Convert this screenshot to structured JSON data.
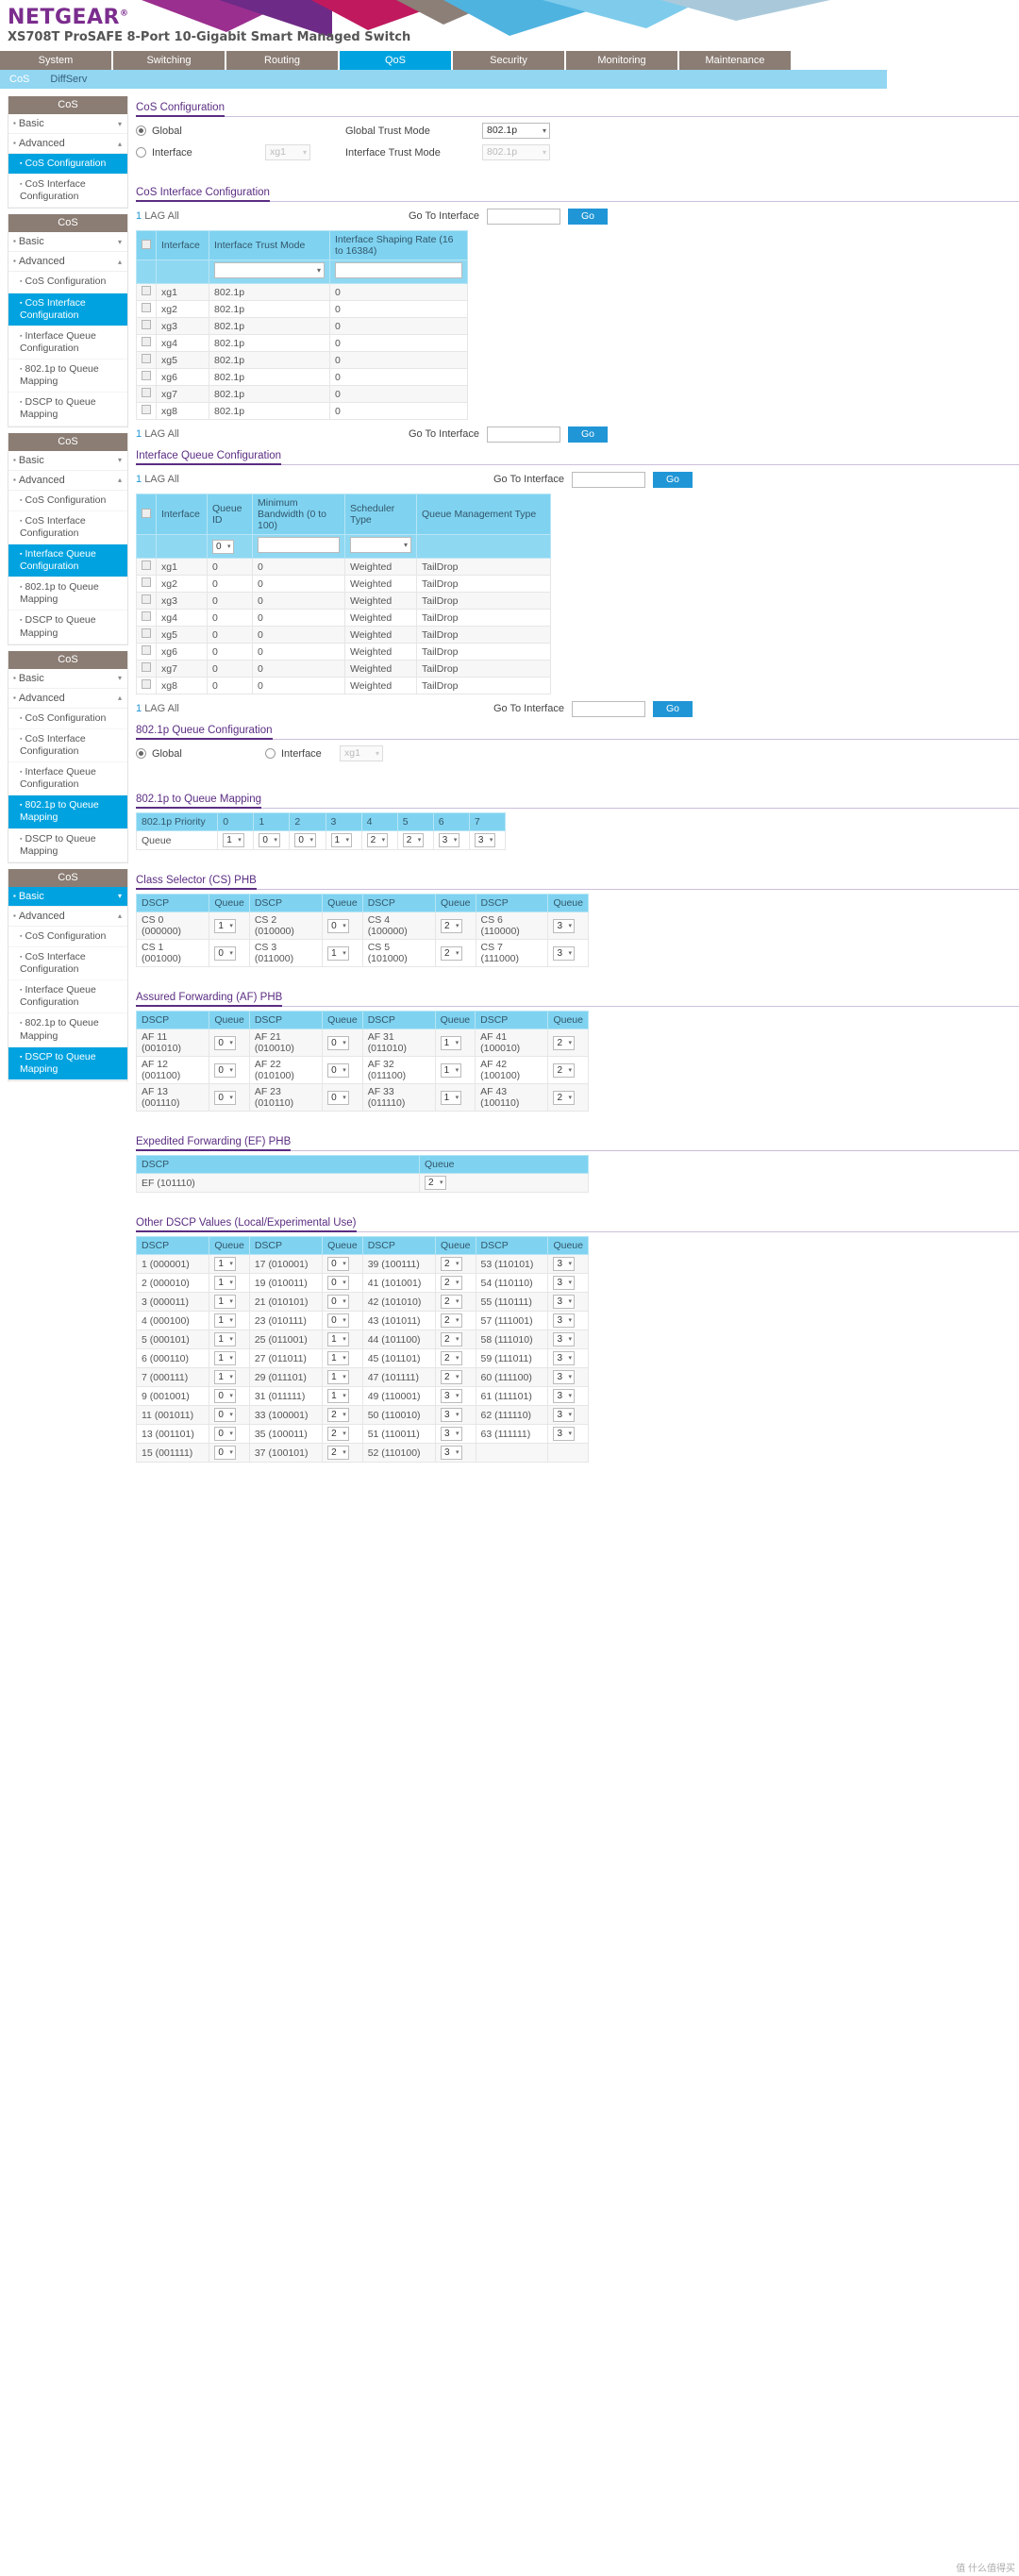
{
  "header": {
    "brand": "NETGEAR",
    "model": "XS708T ProSAFE 8-Port 10-Gigabit Smart Managed Switch"
  },
  "tabs": [
    {
      "label": "System",
      "active": false
    },
    {
      "label": "Switching",
      "active": false
    },
    {
      "label": "Routing",
      "active": false
    },
    {
      "label": "QoS",
      "active": true
    },
    {
      "label": "Security",
      "active": false
    },
    {
      "label": "Monitoring",
      "active": false
    },
    {
      "label": "Maintenance",
      "active": false
    }
  ],
  "subnav": [
    {
      "label": "CoS",
      "active": true
    },
    {
      "label": "DiffServ",
      "active": false
    }
  ],
  "sidebar": {
    "title": "CoS",
    "blocks": [
      {
        "basic": "Basic",
        "advanced": "Advanced",
        "items": [
          {
            "label": "CoS Configuration",
            "selected": true
          },
          {
            "label": "CoS Interface Configuration",
            "selected": false
          }
        ]
      },
      {
        "basic": "Basic",
        "advanced": "Advanced",
        "items": [
          {
            "label": "CoS Configuration",
            "selected": false
          },
          {
            "label": "CoS Interface Configuration",
            "selected": true
          },
          {
            "label": "Interface Queue Configuration",
            "selected": false
          },
          {
            "label": "802.1p to Queue Mapping",
            "selected": false
          },
          {
            "label": "DSCP to Queue Mapping",
            "selected": false
          }
        ]
      },
      {
        "basic": "Basic",
        "advanced": "Advanced",
        "items": [
          {
            "label": "CoS Configuration",
            "selected": false
          },
          {
            "label": "CoS Interface Configuration",
            "selected": false
          },
          {
            "label": "Interface Queue Configuration",
            "selected": true
          },
          {
            "label": "802.1p to Queue Mapping",
            "selected": false
          },
          {
            "label": "DSCP to Queue Mapping",
            "selected": false
          }
        ]
      },
      {
        "basic": "Basic",
        "advanced": "Advanced",
        "items": [
          {
            "label": "CoS Configuration",
            "selected": false
          },
          {
            "label": "CoS Interface Configuration",
            "selected": false
          },
          {
            "label": "Interface Queue Configuration",
            "selected": false
          },
          {
            "label": "802.1p to Queue Mapping",
            "selected": true
          },
          {
            "label": "DSCP to Queue Mapping",
            "selected": false
          }
        ]
      },
      {
        "basic": "Basic",
        "advanced": "Advanced",
        "basic_selected": true,
        "items": [
          {
            "label": "CoS Configuration",
            "selected": false
          },
          {
            "label": "CoS Interface Configuration",
            "selected": false
          },
          {
            "label": "Interface Queue Configuration",
            "selected": false
          },
          {
            "label": "802.1p to Queue Mapping",
            "selected": false
          },
          {
            "label": "DSCP to Queue Mapping",
            "selected": true
          }
        ]
      }
    ]
  },
  "cos_configuration": {
    "heading": "CoS Configuration",
    "global_label": "Global",
    "interface_label": "Interface",
    "global_trust_label": "Global Trust Mode",
    "interface_trust_label": "Interface Trust Mode",
    "global_trust_value": "802.1p",
    "interface_trust_value": "802.1p",
    "interface_select_value": "xg1",
    "global_selected": true
  },
  "cos_interface_configuration": {
    "heading": "CoS Interface Configuration",
    "lag_all": {
      "num": "1",
      "text": "LAG All"
    },
    "goto_label": "Go To Interface",
    "goto_value": "",
    "go_button": "Go",
    "columns": [
      "Interface",
      "Interface Trust Mode",
      "Interface Shaping Rate (16 to 16384)"
    ],
    "filter": {
      "trust_mode": "",
      "shaping_rate": ""
    },
    "rows": [
      {
        "interface": "xg1",
        "trust_mode": "802.1p",
        "shaping_rate": "0"
      },
      {
        "interface": "xg2",
        "trust_mode": "802.1p",
        "shaping_rate": "0"
      },
      {
        "interface": "xg3",
        "trust_mode": "802.1p",
        "shaping_rate": "0"
      },
      {
        "interface": "xg4",
        "trust_mode": "802.1p",
        "shaping_rate": "0"
      },
      {
        "interface": "xg5",
        "trust_mode": "802.1p",
        "shaping_rate": "0"
      },
      {
        "interface": "xg6",
        "trust_mode": "802.1p",
        "shaping_rate": "0"
      },
      {
        "interface": "xg7",
        "trust_mode": "802.1p",
        "shaping_rate": "0"
      },
      {
        "interface": "xg8",
        "trust_mode": "802.1p",
        "shaping_rate": "0"
      }
    ]
  },
  "interface_queue_configuration": {
    "heading": "Interface Queue Configuration",
    "lag_all": {
      "num": "1",
      "text": "LAG All"
    },
    "goto_label": "Go To Interface",
    "goto_value": "",
    "go_button": "Go",
    "columns": [
      "Interface",
      "Queue ID",
      "Minimum Bandwidth (0 to 100)",
      "Scheduler Type",
      "Queue Management Type"
    ],
    "filter": {
      "queue_id": "0",
      "min_bandwidth": "",
      "scheduler_type": ""
    },
    "rows": [
      {
        "interface": "xg1",
        "queue_id": "0",
        "min_bw": "0",
        "scheduler": "Weighted",
        "qmt": "TailDrop"
      },
      {
        "interface": "xg2",
        "queue_id": "0",
        "min_bw": "0",
        "scheduler": "Weighted",
        "qmt": "TailDrop"
      },
      {
        "interface": "xg3",
        "queue_id": "0",
        "min_bw": "0",
        "scheduler": "Weighted",
        "qmt": "TailDrop"
      },
      {
        "interface": "xg4",
        "queue_id": "0",
        "min_bw": "0",
        "scheduler": "Weighted",
        "qmt": "TailDrop"
      },
      {
        "interface": "xg5",
        "queue_id": "0",
        "min_bw": "0",
        "scheduler": "Weighted",
        "qmt": "TailDrop"
      },
      {
        "interface": "xg6",
        "queue_id": "0",
        "min_bw": "0",
        "scheduler": "Weighted",
        "qmt": "TailDrop"
      },
      {
        "interface": "xg7",
        "queue_id": "0",
        "min_bw": "0",
        "scheduler": "Weighted",
        "qmt": "TailDrop"
      },
      {
        "interface": "xg8",
        "queue_id": "0",
        "min_bw": "0",
        "scheduler": "Weighted",
        "qmt": "TailDrop"
      }
    ]
  },
  "dot1p_queue_configuration": {
    "heading": "802.1p Queue Configuration",
    "global_label": "Global",
    "interface_label": "Interface",
    "interface_value": "xg1",
    "global_selected": true
  },
  "dot1p_to_queue_mapping": {
    "heading": "802.1p to Queue Mapping",
    "priority_label": "802.1p Priority",
    "queue_label": "Queue",
    "priorities": [
      "0",
      "1",
      "2",
      "3",
      "4",
      "5",
      "6",
      "7"
    ],
    "queues": [
      "1",
      "0",
      "0",
      "1",
      "2",
      "2",
      "3",
      "3"
    ]
  },
  "cs_phb": {
    "heading": "Class Selector (CS) PHB",
    "columns": [
      "DSCP",
      "Queue",
      "DSCP",
      "Queue",
      "DSCP",
      "Queue",
      "DSCP",
      "Queue"
    ],
    "rows": [
      [
        {
          "dscp": "CS 0 (000000)",
          "q": "1"
        },
        {
          "dscp": "CS 2 (010000)",
          "q": "0"
        },
        {
          "dscp": "CS 4 (100000)",
          "q": "2"
        },
        {
          "dscp": "CS 6 (110000)",
          "q": "3"
        }
      ],
      [
        {
          "dscp": "CS 1 (001000)",
          "q": "0"
        },
        {
          "dscp": "CS 3 (011000)",
          "q": "1"
        },
        {
          "dscp": "CS 5 (101000)",
          "q": "2"
        },
        {
          "dscp": "CS 7 (111000)",
          "q": "3"
        }
      ]
    ]
  },
  "af_phb": {
    "heading": "Assured Forwarding (AF) PHB",
    "columns": [
      "DSCP",
      "Queue",
      "DSCP",
      "Queue",
      "DSCP",
      "Queue",
      "DSCP",
      "Queue"
    ],
    "rows": [
      [
        {
          "dscp": "AF 11 (001010)",
          "q": "0"
        },
        {
          "dscp": "AF 21 (010010)",
          "q": "0"
        },
        {
          "dscp": "AF 31 (011010)",
          "q": "1"
        },
        {
          "dscp": "AF 41 (100010)",
          "q": "2"
        }
      ],
      [
        {
          "dscp": "AF 12 (001100)",
          "q": "0"
        },
        {
          "dscp": "AF 22 (010100)",
          "q": "0"
        },
        {
          "dscp": "AF 32 (011100)",
          "q": "1"
        },
        {
          "dscp": "AF 42 (100100)",
          "q": "2"
        }
      ],
      [
        {
          "dscp": "AF 13 (001110)",
          "q": "0"
        },
        {
          "dscp": "AF 23 (010110)",
          "q": "0"
        },
        {
          "dscp": "AF 33 (011110)",
          "q": "1"
        },
        {
          "dscp": "AF 43 (100110)",
          "q": "2"
        }
      ]
    ]
  },
  "ef_phb": {
    "heading": "Expedited Forwarding (EF) PHB",
    "columns": [
      "DSCP",
      "Queue"
    ],
    "rows": [
      {
        "dscp": "EF (101110)",
        "q": "2"
      }
    ]
  },
  "other_dscp": {
    "heading": "Other DSCP Values (Local/Experimental Use)",
    "columns": [
      "DSCP",
      "Queue",
      "DSCP",
      "Queue",
      "DSCP",
      "Queue",
      "DSCP",
      "Queue"
    ],
    "rows": [
      [
        {
          "dscp": "1 (000001)",
          "q": "1"
        },
        {
          "dscp": "17 (010001)",
          "q": "0"
        },
        {
          "dscp": "39 (100111)",
          "q": "2"
        },
        {
          "dscp": "53 (110101)",
          "q": "3"
        }
      ],
      [
        {
          "dscp": "2 (000010)",
          "q": "1"
        },
        {
          "dscp": "19 (010011)",
          "q": "0"
        },
        {
          "dscp": "41 (101001)",
          "q": "2"
        },
        {
          "dscp": "54 (110110)",
          "q": "3"
        }
      ],
      [
        {
          "dscp": "3 (000011)",
          "q": "1"
        },
        {
          "dscp": "21 (010101)",
          "q": "0"
        },
        {
          "dscp": "42 (101010)",
          "q": "2"
        },
        {
          "dscp": "55 (110111)",
          "q": "3"
        }
      ],
      [
        {
          "dscp": "4 (000100)",
          "q": "1"
        },
        {
          "dscp": "23 (010111)",
          "q": "0"
        },
        {
          "dscp": "43 (101011)",
          "q": "2"
        },
        {
          "dscp": "57 (111001)",
          "q": "3"
        }
      ],
      [
        {
          "dscp": "5 (000101)",
          "q": "1"
        },
        {
          "dscp": "25 (011001)",
          "q": "1"
        },
        {
          "dscp": "44 (101100)",
          "q": "2"
        },
        {
          "dscp": "58 (111010)",
          "q": "3"
        }
      ],
      [
        {
          "dscp": "6 (000110)",
          "q": "1"
        },
        {
          "dscp": "27 (011011)",
          "q": "1"
        },
        {
          "dscp": "45 (101101)",
          "q": "2"
        },
        {
          "dscp": "59 (111011)",
          "q": "3"
        }
      ],
      [
        {
          "dscp": "7 (000111)",
          "q": "1"
        },
        {
          "dscp": "29 (011101)",
          "q": "1"
        },
        {
          "dscp": "47 (101111)",
          "q": "2"
        },
        {
          "dscp": "60 (111100)",
          "q": "3"
        }
      ],
      [
        {
          "dscp": "9 (001001)",
          "q": "0"
        },
        {
          "dscp": "31 (011111)",
          "q": "1"
        },
        {
          "dscp": "49 (110001)",
          "q": "3"
        },
        {
          "dscp": "61 (111101)",
          "q": "3"
        }
      ],
      [
        {
          "dscp": "11 (001011)",
          "q": "0"
        },
        {
          "dscp": "33 (100001)",
          "q": "2"
        },
        {
          "dscp": "50 (110010)",
          "q": "3"
        },
        {
          "dscp": "62 (111110)",
          "q": "3"
        }
      ],
      [
        {
          "dscp": "13 (001101)",
          "q": "0"
        },
        {
          "dscp": "35 (100011)",
          "q": "2"
        },
        {
          "dscp": "51 (110011)",
          "q": "3"
        },
        {
          "dscp": "63 (111111)",
          "q": "3"
        }
      ],
      [
        {
          "dscp": "15 (001111)",
          "q": "0"
        },
        {
          "dscp": "37 (100101)",
          "q": "2"
        },
        {
          "dscp": "52 (110100)",
          "q": "3"
        },
        {
          "dscp": "",
          "q": ""
        }
      ]
    ]
  },
  "watermark": "值 什么值得买"
}
